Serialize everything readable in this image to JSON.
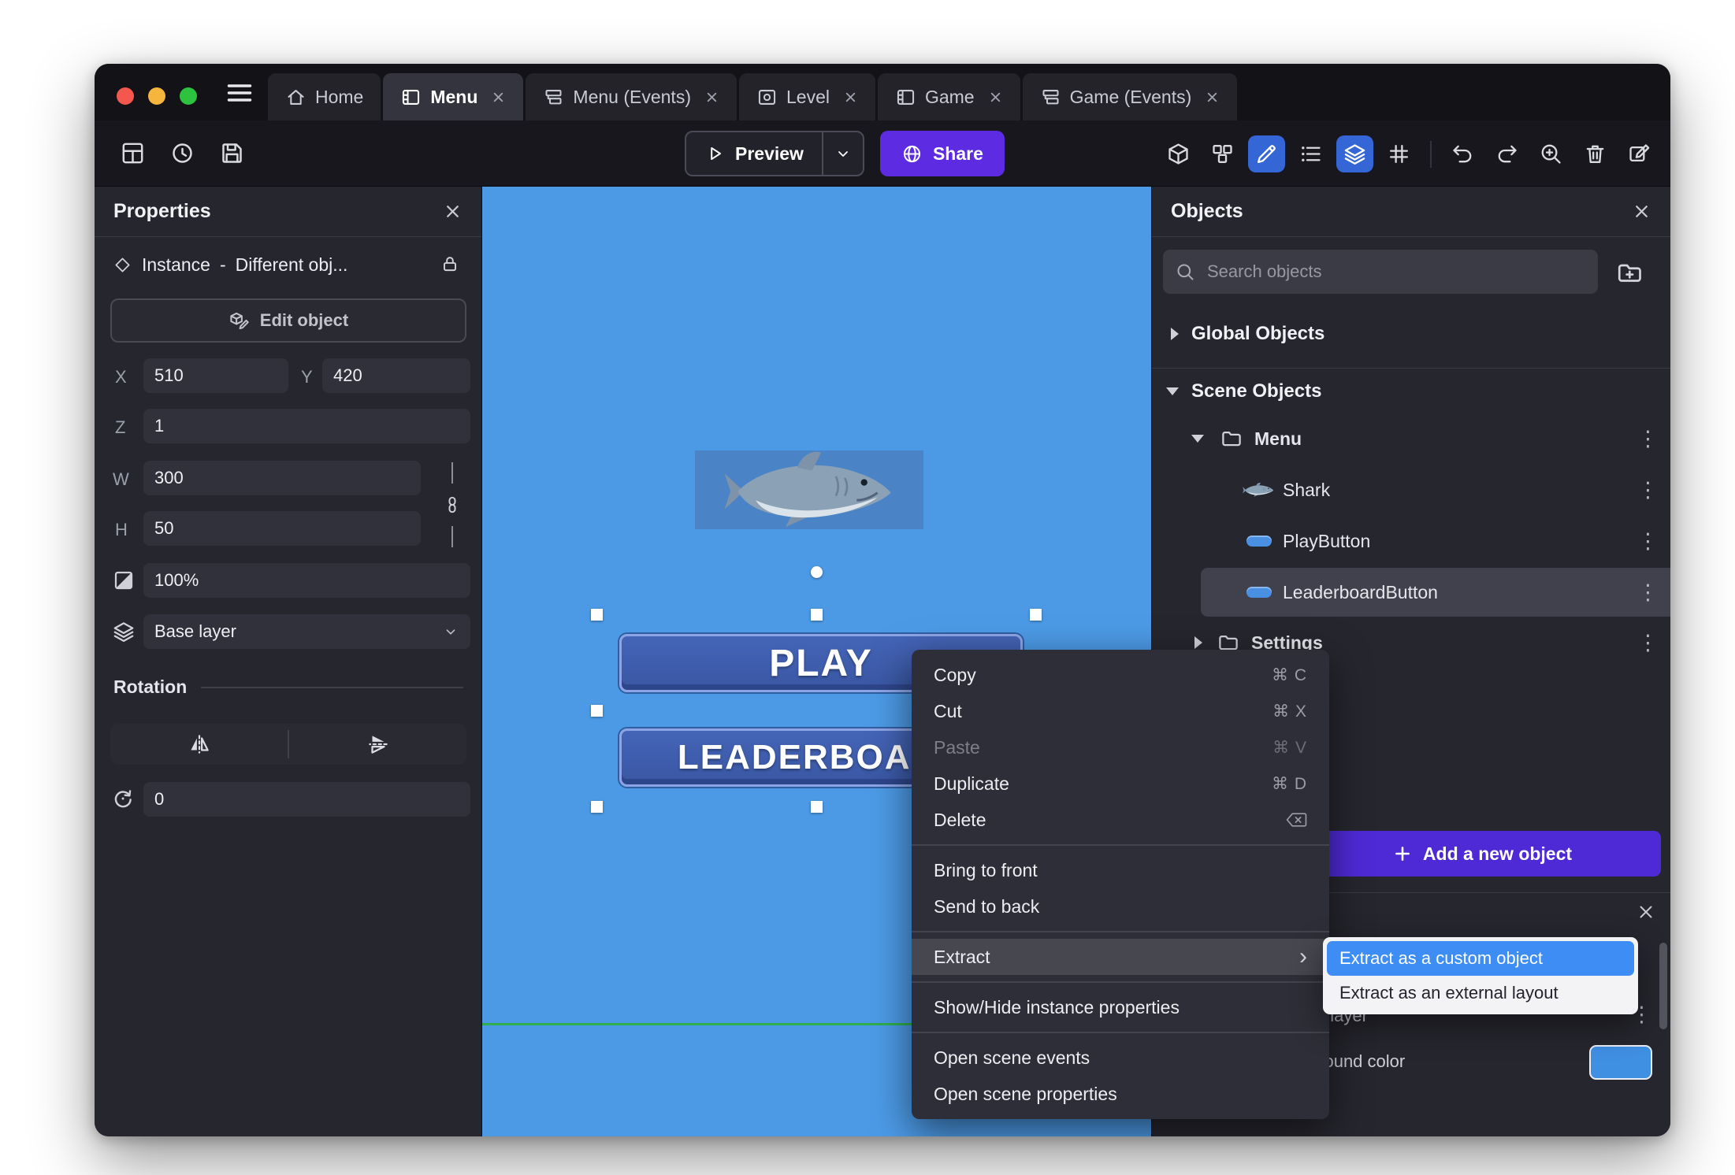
{
  "colors": {
    "canvas_background": "#4c9ae6",
    "accent_purple": "#5c2be2",
    "selection_blue": "#3d8df5",
    "layer_swatch": "#3f8fe3"
  },
  "glyphs": {
    "kebab": "⋮",
    "submenu_arrow": "›"
  },
  "titlebar": {
    "tabs": [
      {
        "label": "Home"
      },
      {
        "label": "Menu"
      },
      {
        "label": "Menu (Events)"
      },
      {
        "label": "Level"
      },
      {
        "label": "Game"
      },
      {
        "label": "Game (Events)"
      }
    ]
  },
  "toolbar": {
    "preview": "Preview",
    "share": "Share"
  },
  "properties": {
    "title": "Properties",
    "instance_type": "Instance",
    "separator": "-",
    "instance_name": "Different obj...",
    "edit_object": "Edit object",
    "x_label": "X",
    "x": "510",
    "y_label": "Y",
    "y": "420",
    "z_label": "Z",
    "z": "1",
    "w_label": "W",
    "w": "300",
    "h_label": "H",
    "h": "50",
    "opacity": "100%",
    "layer": "Base layer",
    "rotation_title": "Rotation",
    "rotation": "0"
  },
  "canvas": {
    "play": "PLAY",
    "leaderboard": "LEADERBOARD"
  },
  "objects": {
    "title": "Objects",
    "search_placeholder": "Search objects",
    "global_objects": "Global Objects",
    "scene_objects": "Scene Objects",
    "menu_folder": "Menu",
    "shark": "Shark",
    "play_button": "PlayButton",
    "leaderboard_button": "LeaderboardButton",
    "settings_folder": "Settings",
    "add_new_object": "Add a new object"
  },
  "context_menu": {
    "copy": "Copy",
    "copy_sc": "⌘ C",
    "cut": "Cut",
    "cut_sc": "⌘ X",
    "paste": "Paste",
    "paste_sc": "⌘ V",
    "duplicate": "Duplicate",
    "duplicate_sc": "⌘ D",
    "delete": "Delete",
    "bring_to_front": "Bring to front",
    "send_to_back": "Send to back",
    "extract": "Extract",
    "show_hide": "Show/Hide instance properties",
    "open_scene_events": "Open scene events",
    "open_scene_properties": "Open scene properties",
    "submenu": {
      "custom_object": "Extract as a custom object",
      "external_layout": "Extract as an external layout"
    }
  },
  "layers": {
    "layer_name": "Base layer",
    "background_color": "Background color"
  }
}
